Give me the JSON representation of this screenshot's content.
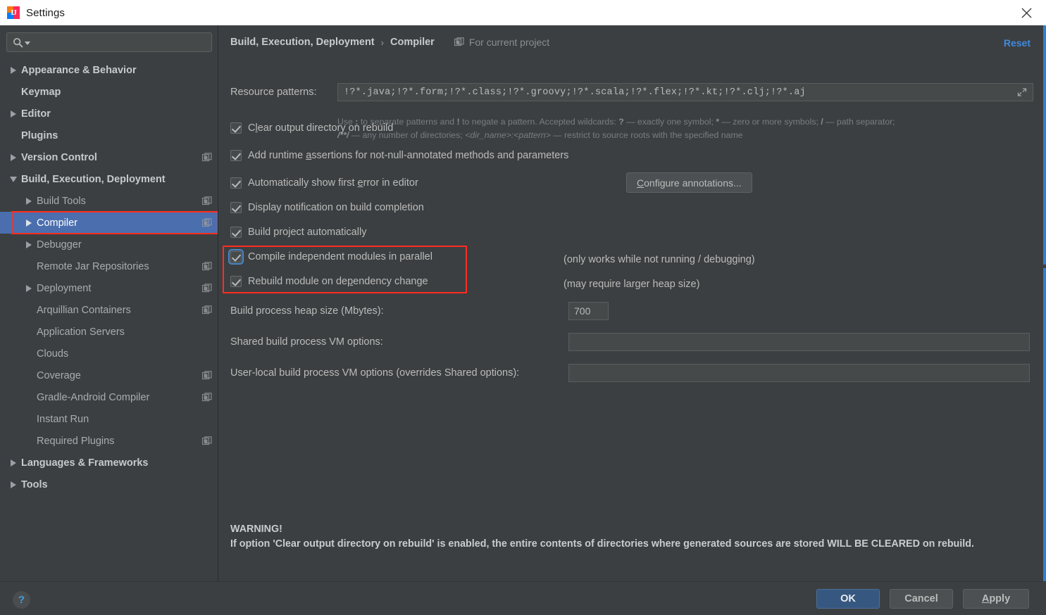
{
  "window": {
    "title": "Settings",
    "app_icon": "intellij-idea-icon",
    "close_icon": "close-icon"
  },
  "sidebar": {
    "search": {
      "placeholder": "",
      "value": "",
      "icon": "search-icon",
      "caret_icon": "chevron-down-icon"
    },
    "items": [
      {
        "label": "Appearance & Behavior",
        "level": 0,
        "twisty": "right",
        "bold": true,
        "project_icon": false
      },
      {
        "label": "Keymap",
        "level": 0,
        "twisty": "none",
        "bold": true,
        "project_icon": false
      },
      {
        "label": "Editor",
        "level": 0,
        "twisty": "right",
        "bold": true,
        "project_icon": false
      },
      {
        "label": "Plugins",
        "level": 0,
        "twisty": "none",
        "bold": true,
        "project_icon": false
      },
      {
        "label": "Version Control",
        "level": 0,
        "twisty": "right",
        "bold": true,
        "project_icon": true
      },
      {
        "label": "Build, Execution, Deployment",
        "level": 0,
        "twisty": "down",
        "bold": true,
        "project_icon": false
      },
      {
        "label": "Build Tools",
        "level": 1,
        "twisty": "right",
        "bold": false,
        "project_icon": true
      },
      {
        "label": "Compiler",
        "level": 1,
        "twisty": "right",
        "bold": false,
        "project_icon": true,
        "selected": true,
        "highlighted": true
      },
      {
        "label": "Debugger",
        "level": 1,
        "twisty": "right",
        "bold": false,
        "project_icon": false
      },
      {
        "label": "Remote Jar Repositories",
        "level": 1,
        "twisty": "none",
        "bold": false,
        "project_icon": true
      },
      {
        "label": "Deployment",
        "level": 1,
        "twisty": "right",
        "bold": false,
        "project_icon": true
      },
      {
        "label": "Arquillian Containers",
        "level": 1,
        "twisty": "none",
        "bold": false,
        "project_icon": true
      },
      {
        "label": "Application Servers",
        "level": 1,
        "twisty": "none",
        "bold": false,
        "project_icon": false
      },
      {
        "label": "Clouds",
        "level": 1,
        "twisty": "none",
        "bold": false,
        "project_icon": false
      },
      {
        "label": "Coverage",
        "level": 1,
        "twisty": "none",
        "bold": false,
        "project_icon": true
      },
      {
        "label": "Gradle-Android Compiler",
        "level": 1,
        "twisty": "none",
        "bold": false,
        "project_icon": true
      },
      {
        "label": "Instant Run",
        "level": 1,
        "twisty": "none",
        "bold": false,
        "project_icon": false
      },
      {
        "label": "Required Plugins",
        "level": 1,
        "twisty": "none",
        "bold": false,
        "project_icon": true
      },
      {
        "label": "Languages & Frameworks",
        "level": 0,
        "twisty": "right",
        "bold": true,
        "project_icon": false
      },
      {
        "label": "Tools",
        "level": 0,
        "twisty": "right",
        "bold": true,
        "project_icon": false
      }
    ]
  },
  "main": {
    "breadcrumb": {
      "root": "Build, Execution, Deployment",
      "separator": "›",
      "leaf": "Compiler",
      "scope_label": "For current project",
      "scope_icon": "project-scope-icon"
    },
    "reset_label": "Reset",
    "resource_patterns": {
      "label": "Resource patterns:",
      "value": "!?*.java;!?*.form;!?*.class;!?*.groovy;!?*.scala;!?*.flex;!?*.kt;!?*.clj;!?*.aj",
      "placeholder": "",
      "expand_icon": "expand-icon"
    },
    "hint": {
      "line1_a": "Use ",
      "line1_semicolon": ";",
      "line1_b": " to separate patterns and ",
      "line1_bang": "!",
      "line1_c": " to negate a pattern. Accepted wildcards: ",
      "line1_q": "?",
      "line1_d": " — exactly one symbol; ",
      "line1_star": "*",
      "line1_e": " — zero or more symbols; ",
      "line1_slash": "/",
      "line1_f": " — path separator;",
      "line2_a": "/**/",
      "line2_b": " — any number of directories; ",
      "line2_dir": "<dir_name>:<pattern>",
      "line2_c": " — restrict to source roots with the specified name"
    },
    "checkboxes": [
      {
        "label_pre": "C",
        "mnemonic": "l",
        "label_post": "ear output directory on rebuild",
        "checked": true,
        "focused": false
      },
      {
        "label_pre": "Add runtime ",
        "mnemonic": "a",
        "label_post": "ssertions for not-null-annotated methods and parameters",
        "checked": true,
        "focused": false
      },
      {
        "label_pre": "Automatically show first ",
        "mnemonic": "e",
        "label_post": "rror in editor",
        "checked": true,
        "focused": false
      },
      {
        "label_pre": "Display notification on build completion",
        "mnemonic": "",
        "label_post": "",
        "checked": true,
        "focused": false
      },
      {
        "label_pre": "Build project automatically",
        "mnemonic": "",
        "label_post": "",
        "checked": true,
        "focused": false
      },
      {
        "label_pre": "Compile independent modules in parallel",
        "mnemonic": "",
        "label_post": "",
        "checked": true,
        "focused": true
      },
      {
        "label_pre": "Rebuild module on de",
        "mnemonic": "p",
        "label_post": "endency change",
        "checked": true,
        "focused": false
      }
    ],
    "configure_annotations": {
      "pre": "",
      "mnemonic": "C",
      "post": "onfigure annotations..."
    },
    "notes": {
      "build_auto": "(only works while not running / debugging)",
      "parallel": "(may require larger heap size)"
    },
    "fields": [
      {
        "label": "Build process heap size (Mbytes):",
        "value": "700"
      },
      {
        "label": "Shared build process VM options:",
        "value": ""
      },
      {
        "label": "User-local build process VM options (overrides Shared options):",
        "value": ""
      }
    ],
    "warning": {
      "title": "WARNING!",
      "body": "If option 'Clear output directory on rebuild' is enabled, the entire contents of directories where generated sources are stored WILL BE CLEARED on rebuild."
    }
  },
  "footer": {
    "help_label": "?",
    "ok": "OK",
    "cancel": "Cancel",
    "apply_mnemonic": "A",
    "apply_rest": "pply"
  },
  "colors": {
    "window_bg": "#3c3f41",
    "selection_blue": "#4b6eaf",
    "highlight_red": "#ff2d20",
    "link_blue": "#3f8ae0",
    "primary_button": "#365880",
    "scrollbar_blue": "#2d7fd6"
  }
}
